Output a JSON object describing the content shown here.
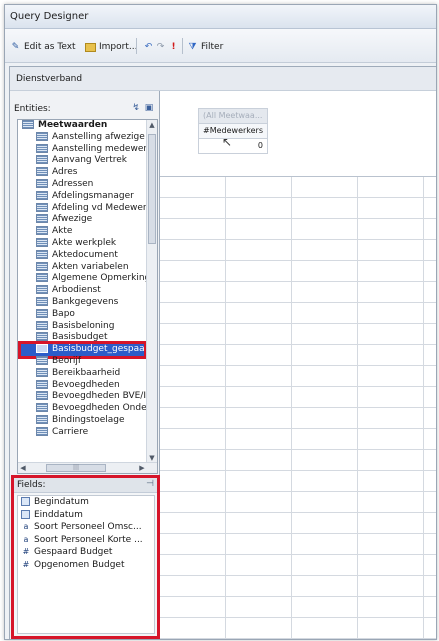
{
  "window": {
    "title": "Query Designer"
  },
  "toolbar": {
    "edit_as_text": "Edit as Text",
    "import": "Import...",
    "filter": "Filter"
  },
  "cube": {
    "name": "Dienstverband"
  },
  "entities": {
    "label": "Entities:",
    "items": [
      {
        "label": "Meetwaarden",
        "kind": "parent"
      },
      {
        "label": "Aanstelling afwezige"
      },
      {
        "label": "Aanstelling medewerk"
      },
      {
        "label": "Aanvang Vertrek"
      },
      {
        "label": "Adres"
      },
      {
        "label": "Adressen"
      },
      {
        "label": "Afdelingsmanager"
      },
      {
        "label": "Afdeling vd Medewerl"
      },
      {
        "label": "Afwezige"
      },
      {
        "label": "Akte"
      },
      {
        "label": "Akte werkplek"
      },
      {
        "label": "Aktedocument"
      },
      {
        "label": "Akten variabelen"
      },
      {
        "label": "Algemene Opmerking"
      },
      {
        "label": "Arbodienst"
      },
      {
        "label": "Bankgegevens"
      },
      {
        "label": "Bapo"
      },
      {
        "label": "Basisbeloning"
      },
      {
        "label": "Basisbudget"
      },
      {
        "label": "Basisbudget_gespaar",
        "kind": "selected"
      },
      {
        "label": "Beorijf"
      },
      {
        "label": "Bereikbaarheid"
      },
      {
        "label": "Bevoegdheden"
      },
      {
        "label": "Bevoegdheden BVE/I"
      },
      {
        "label": "Bevoegdheden Onde"
      },
      {
        "label": "Bindingstoelage"
      },
      {
        "label": "Carriere"
      }
    ]
  },
  "fields": {
    "label": "Fields:",
    "items": [
      {
        "label": "Begindatum",
        "icon": "date-icon"
      },
      {
        "label": "Einddatum",
        "icon": "date-icon"
      },
      {
        "label": "Soort Personeel Omsc...",
        "icon": "text-attribute-icon",
        "glyph": "a"
      },
      {
        "label": "Soort Personeel Korte ...",
        "icon": "text-attribute-icon",
        "glyph": "a"
      },
      {
        "label": "Gespaard Budget",
        "icon": "numeric-measure-icon",
        "glyph": "#"
      },
      {
        "label": "Opgenomen Budget",
        "icon": "numeric-measure-icon",
        "glyph": "#"
      }
    ]
  },
  "measure_box": {
    "header": "(All Meetwaa...",
    "column": "#Medewerkers",
    "value": "0"
  },
  "colors": {
    "selection": "#2b5cc9",
    "highlight": "#d6152a"
  }
}
